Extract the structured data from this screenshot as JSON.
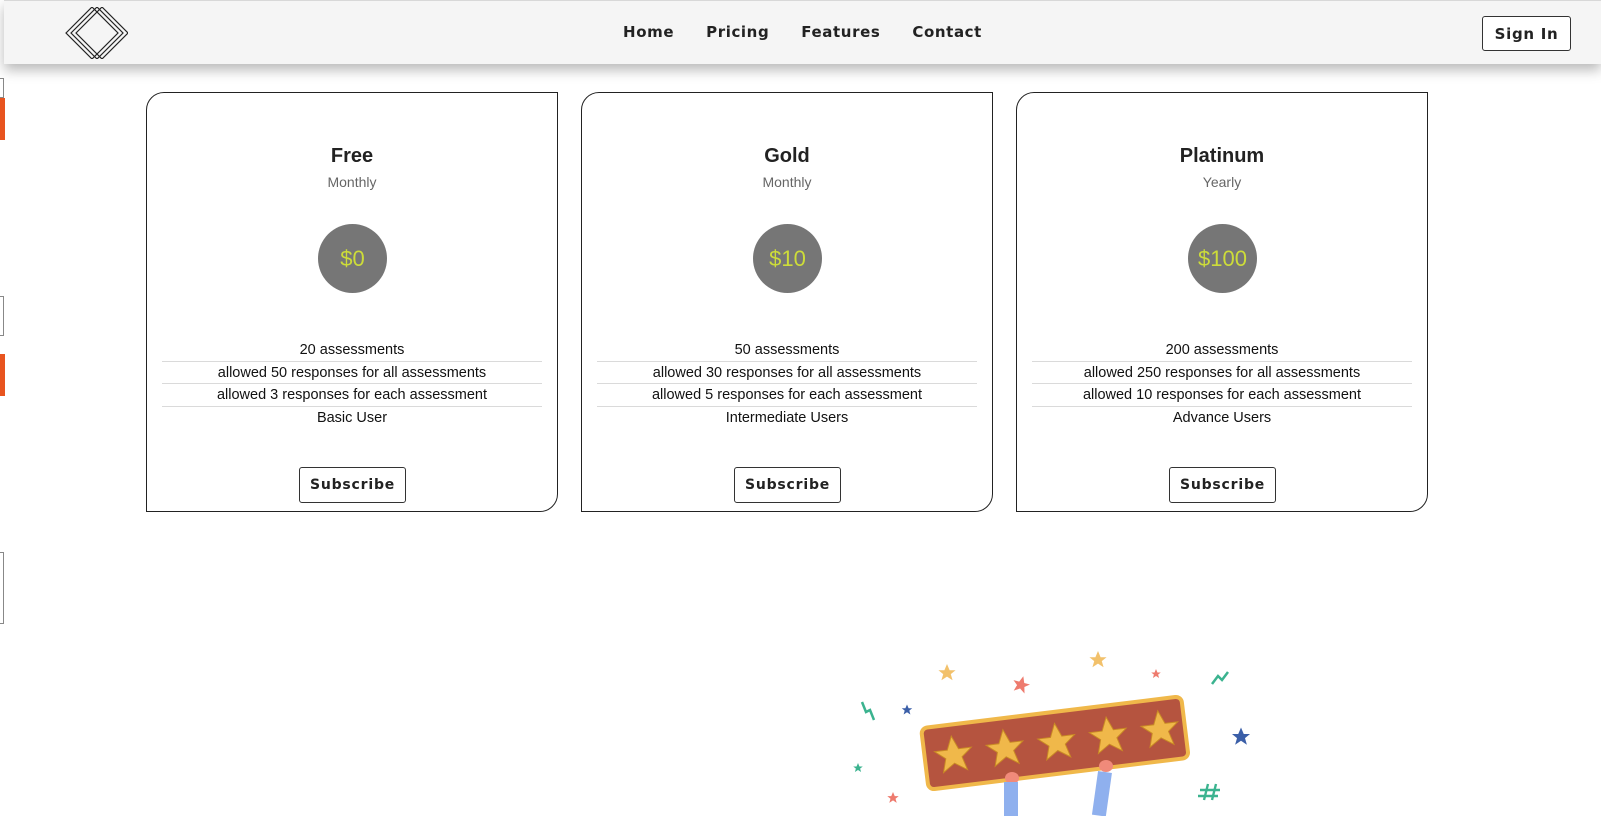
{
  "header": {
    "logo_icon": "diamond-outline-logo",
    "nav": [
      "Home",
      "Pricing",
      "Features",
      "Contact"
    ],
    "signin_label": "Sign In"
  },
  "plans": [
    {
      "name": "Free",
      "period": "Monthly",
      "price": "$0",
      "features": [
        "20 assessments",
        "allowed 50 responses for all assessments",
        "allowed 3 responses for each assessment",
        "Basic User"
      ],
      "cta": "Subscribe"
    },
    {
      "name": "Gold",
      "period": "Monthly",
      "price": "$10",
      "features": [
        "50 assessments",
        "allowed 30 responses for all assessments",
        "allowed 5 responses for each assessment",
        "Intermediate Users"
      ],
      "cta": "Subscribe"
    },
    {
      "name": "Platinum",
      "period": "Yearly",
      "price": "$100",
      "features": [
        "200 assessments",
        "allowed 250 responses for all assessments",
        "allowed 10 responses for each assessment",
        "Advance Users"
      ],
      "cta": "Subscribe"
    }
  ],
  "illustration": {
    "icon": "five-star-rating-illustration",
    "stars": 5
  },
  "colors": {
    "price_circle": "#767676",
    "price_text": "#cddc39",
    "accent_orange": "#e8541f",
    "rating_board": "#b5543f",
    "star_gold": "#f0b84a"
  }
}
